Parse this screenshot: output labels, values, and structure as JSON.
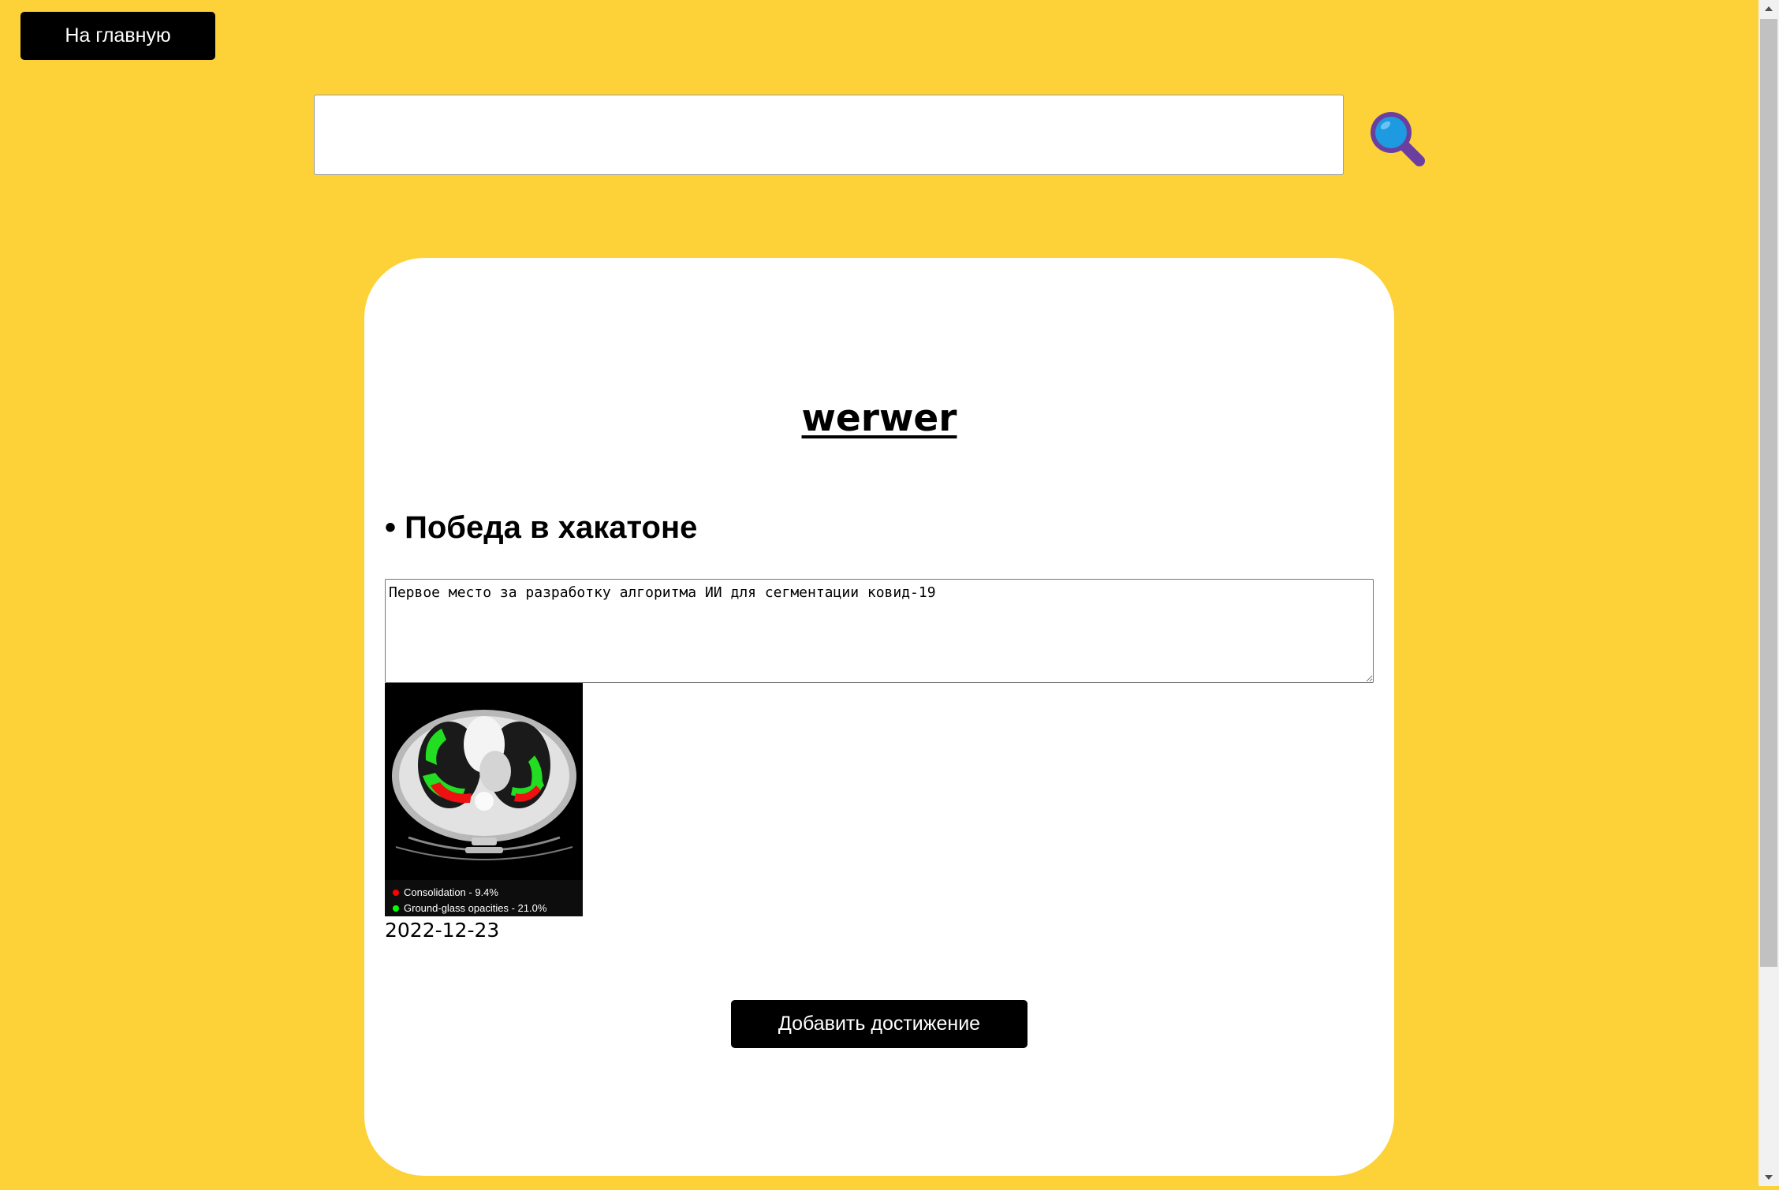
{
  "header": {
    "home_button_label": "На главную"
  },
  "search": {
    "value": "",
    "placeholder": ""
  },
  "card": {
    "title": "werwer",
    "achievement": {
      "title": "• Победа в хакатоне",
      "description": "Первое место за разработку алгоритма ИИ для сегментации ковид-19",
      "image": {
        "legend": [
          {
            "label": "Consolidation - 9.4%",
            "color": "#ff0000"
          },
          {
            "label": "Ground-glass opacities - 21.0%",
            "color": "#00ff00"
          }
        ]
      },
      "date": "2022-12-23"
    },
    "add_button_label": "Добавить достижение"
  },
  "colors": {
    "background": "#fdd138",
    "card": "#ffffff",
    "button": "#000000",
    "search_icon_lens": "#1e9ae0",
    "search_icon_handle": "#6b3fa0"
  }
}
